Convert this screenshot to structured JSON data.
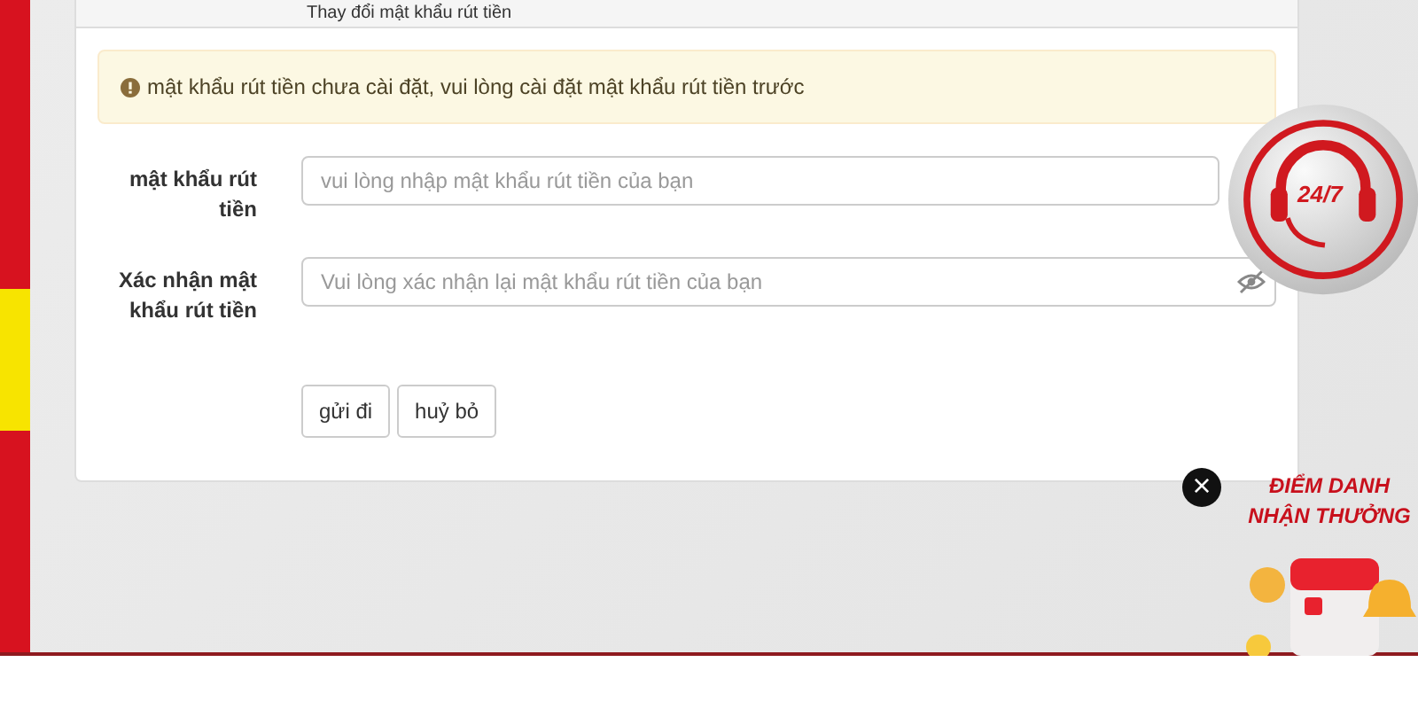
{
  "panel": {
    "title": "Thay đổi mật khẩu rút tiền"
  },
  "alert": {
    "text": "mật khẩu rút tiền chưa cài đặt, vui lòng cài đặt mật khẩu rút tiền trước"
  },
  "fields": [
    {
      "label": "mật khẩu rút tiền",
      "placeholder": "vui lòng nhập mật khẩu rút tiền của bạn"
    },
    {
      "label": "Xác nhận mật khẩu rút tiền",
      "placeholder": "Vui lòng xác nhận lại mật khẩu rút tiền của bạn",
      "password_hidden": true
    }
  ],
  "buttons": [
    "gửi đi",
    "huỷ bỏ"
  ],
  "support": {
    "badge": "24/7"
  },
  "promo": {
    "close": "×",
    "lines": [
      "ĐIỂM DANH",
      "NHẬN THƯỞNG"
    ]
  }
}
